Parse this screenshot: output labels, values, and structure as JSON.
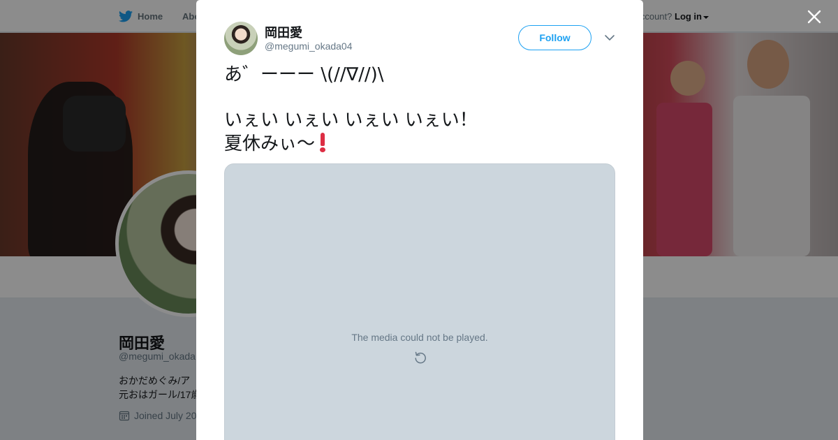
{
  "topbar": {
    "home_label": "Home",
    "about_label": "Abo",
    "login_prompt": "account?",
    "login_label": "Log in"
  },
  "profile": {
    "name": "岡田愛",
    "handle": "@megumi_okada",
    "bio_line1": "おかだめぐみ/ア",
    "bio_line2": "元おはガール/17歳",
    "joined": "Joined July 20"
  },
  "tweet": {
    "author_name": "岡田愛",
    "author_handle": "@megumi_okada04",
    "follow_label": "Follow",
    "text_line1": "あ゛ーーー \\(//∇//)\\",
    "text_line2": "いぇい いぇい いぇい いぇい！",
    "text_line3": "夏休みぃ〜",
    "emoji": "heavy-exclamation-mark",
    "media_error": "The media could not be played."
  },
  "colors": {
    "brand": "#1da1f2",
    "media_bg": "#ccd6dd",
    "overlay": "rgba(0,0,0,0.45)",
    "exclamation": "#dd2e44"
  },
  "icons": [
    "twitter-bird-icon",
    "calendar-icon",
    "close-icon",
    "chevron-down-icon",
    "reload-icon"
  ]
}
